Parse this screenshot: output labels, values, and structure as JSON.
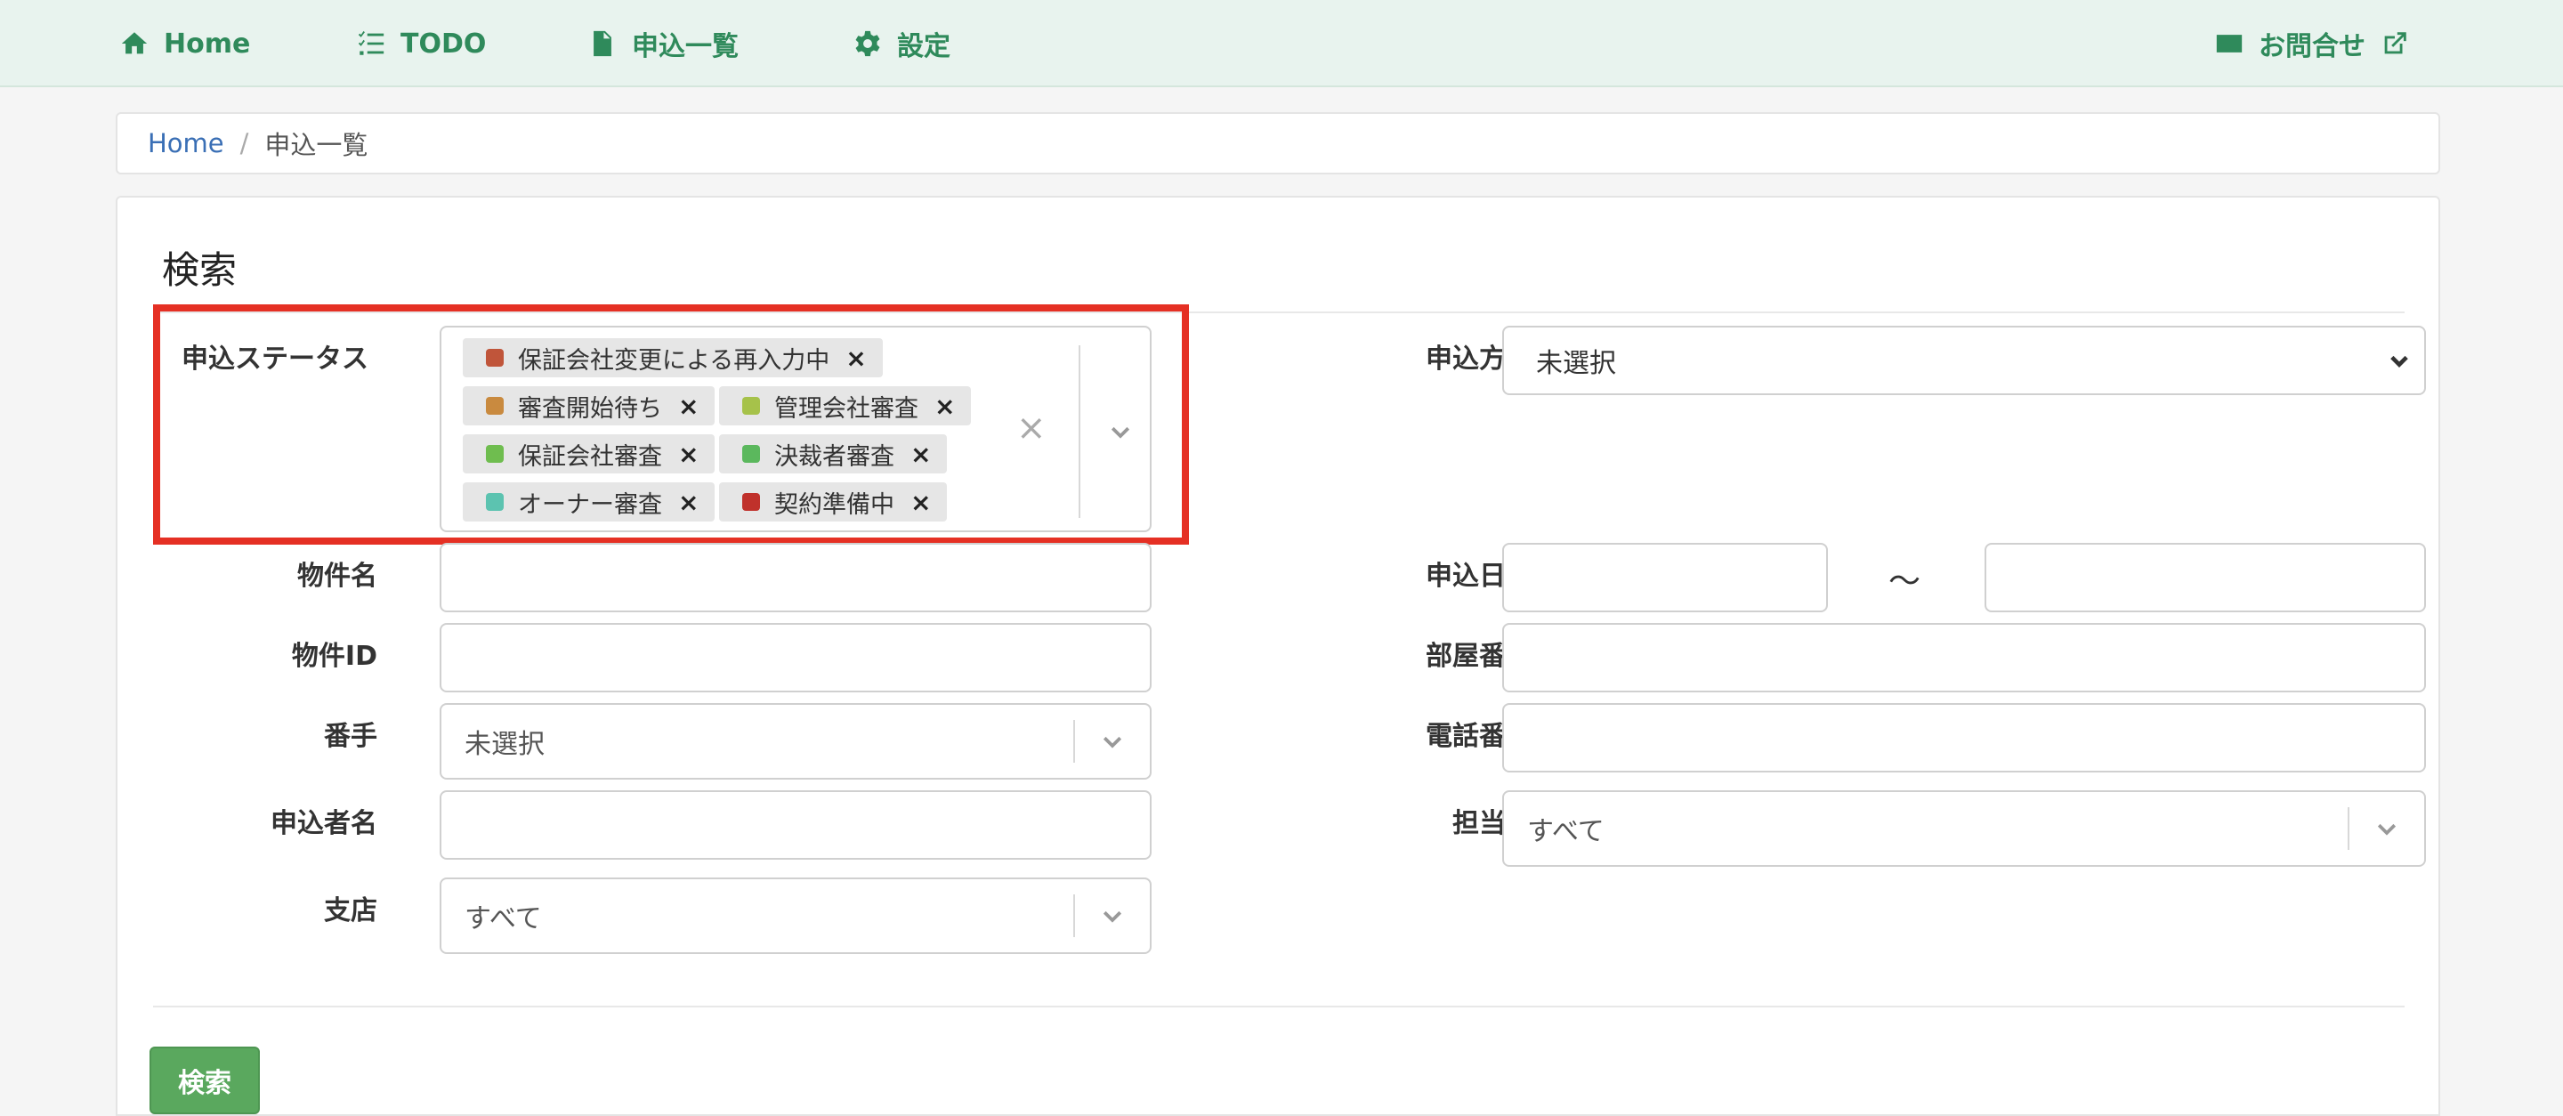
{
  "nav": {
    "items": [
      {
        "label": "Home",
        "icon": "home-icon"
      },
      {
        "label": "TODO",
        "icon": "list-icon"
      },
      {
        "label": "申込一覧",
        "icon": "document-icon"
      },
      {
        "label": "設定",
        "icon": "gear-icon"
      }
    ],
    "contact": {
      "label": "お問合せ",
      "icon": "envelope-icon",
      "trailing_icon": "external-link-icon"
    }
  },
  "breadcrumb": {
    "home": "Home",
    "separator": "/",
    "current": "申込一覧"
  },
  "search": {
    "title": "検索",
    "fields": {
      "status": {
        "label": "申込ステータス",
        "clear": "×",
        "tags": [
          {
            "label": "保証会社変更による再入力中",
            "color": "#c0553a"
          },
          {
            "label": "審査開始待ち",
            "color": "#c98a3f"
          },
          {
            "label": "管理会社審査",
            "color": "#a6c24a"
          },
          {
            "label": "保証会社審査",
            "color": "#6fbd4f"
          },
          {
            "label": "決裁者審査",
            "color": "#5bb85d"
          },
          {
            "label": "オーナー審査",
            "color": "#5cc3b0"
          },
          {
            "label": "契約準備中",
            "color": "#c0312b"
          }
        ]
      },
      "property_name": {
        "label": "物件名",
        "value": ""
      },
      "property_id": {
        "label": "物件ID",
        "value": ""
      },
      "number": {
        "label": "番手",
        "value": "未選択"
      },
      "applicant": {
        "label": "申込者名",
        "value": ""
      },
      "branch": {
        "label": "支店",
        "value": "すべて"
      },
      "method": {
        "label": "申込方法",
        "value": "未選択"
      },
      "date": {
        "label": "申込日時",
        "separator": "～",
        "from": "",
        "to": ""
      },
      "room": {
        "label": "部屋番号",
        "value": ""
      },
      "phone": {
        "label": "電話番号",
        "value": ""
      },
      "staff": {
        "label": "担当者",
        "value": "すべて"
      }
    },
    "submit_label": "検索"
  },
  "colors": {
    "accent": "#2f8a5b",
    "highlight": "#e53024",
    "button": "#5aa85e",
    "link": "#3a6fb5"
  }
}
